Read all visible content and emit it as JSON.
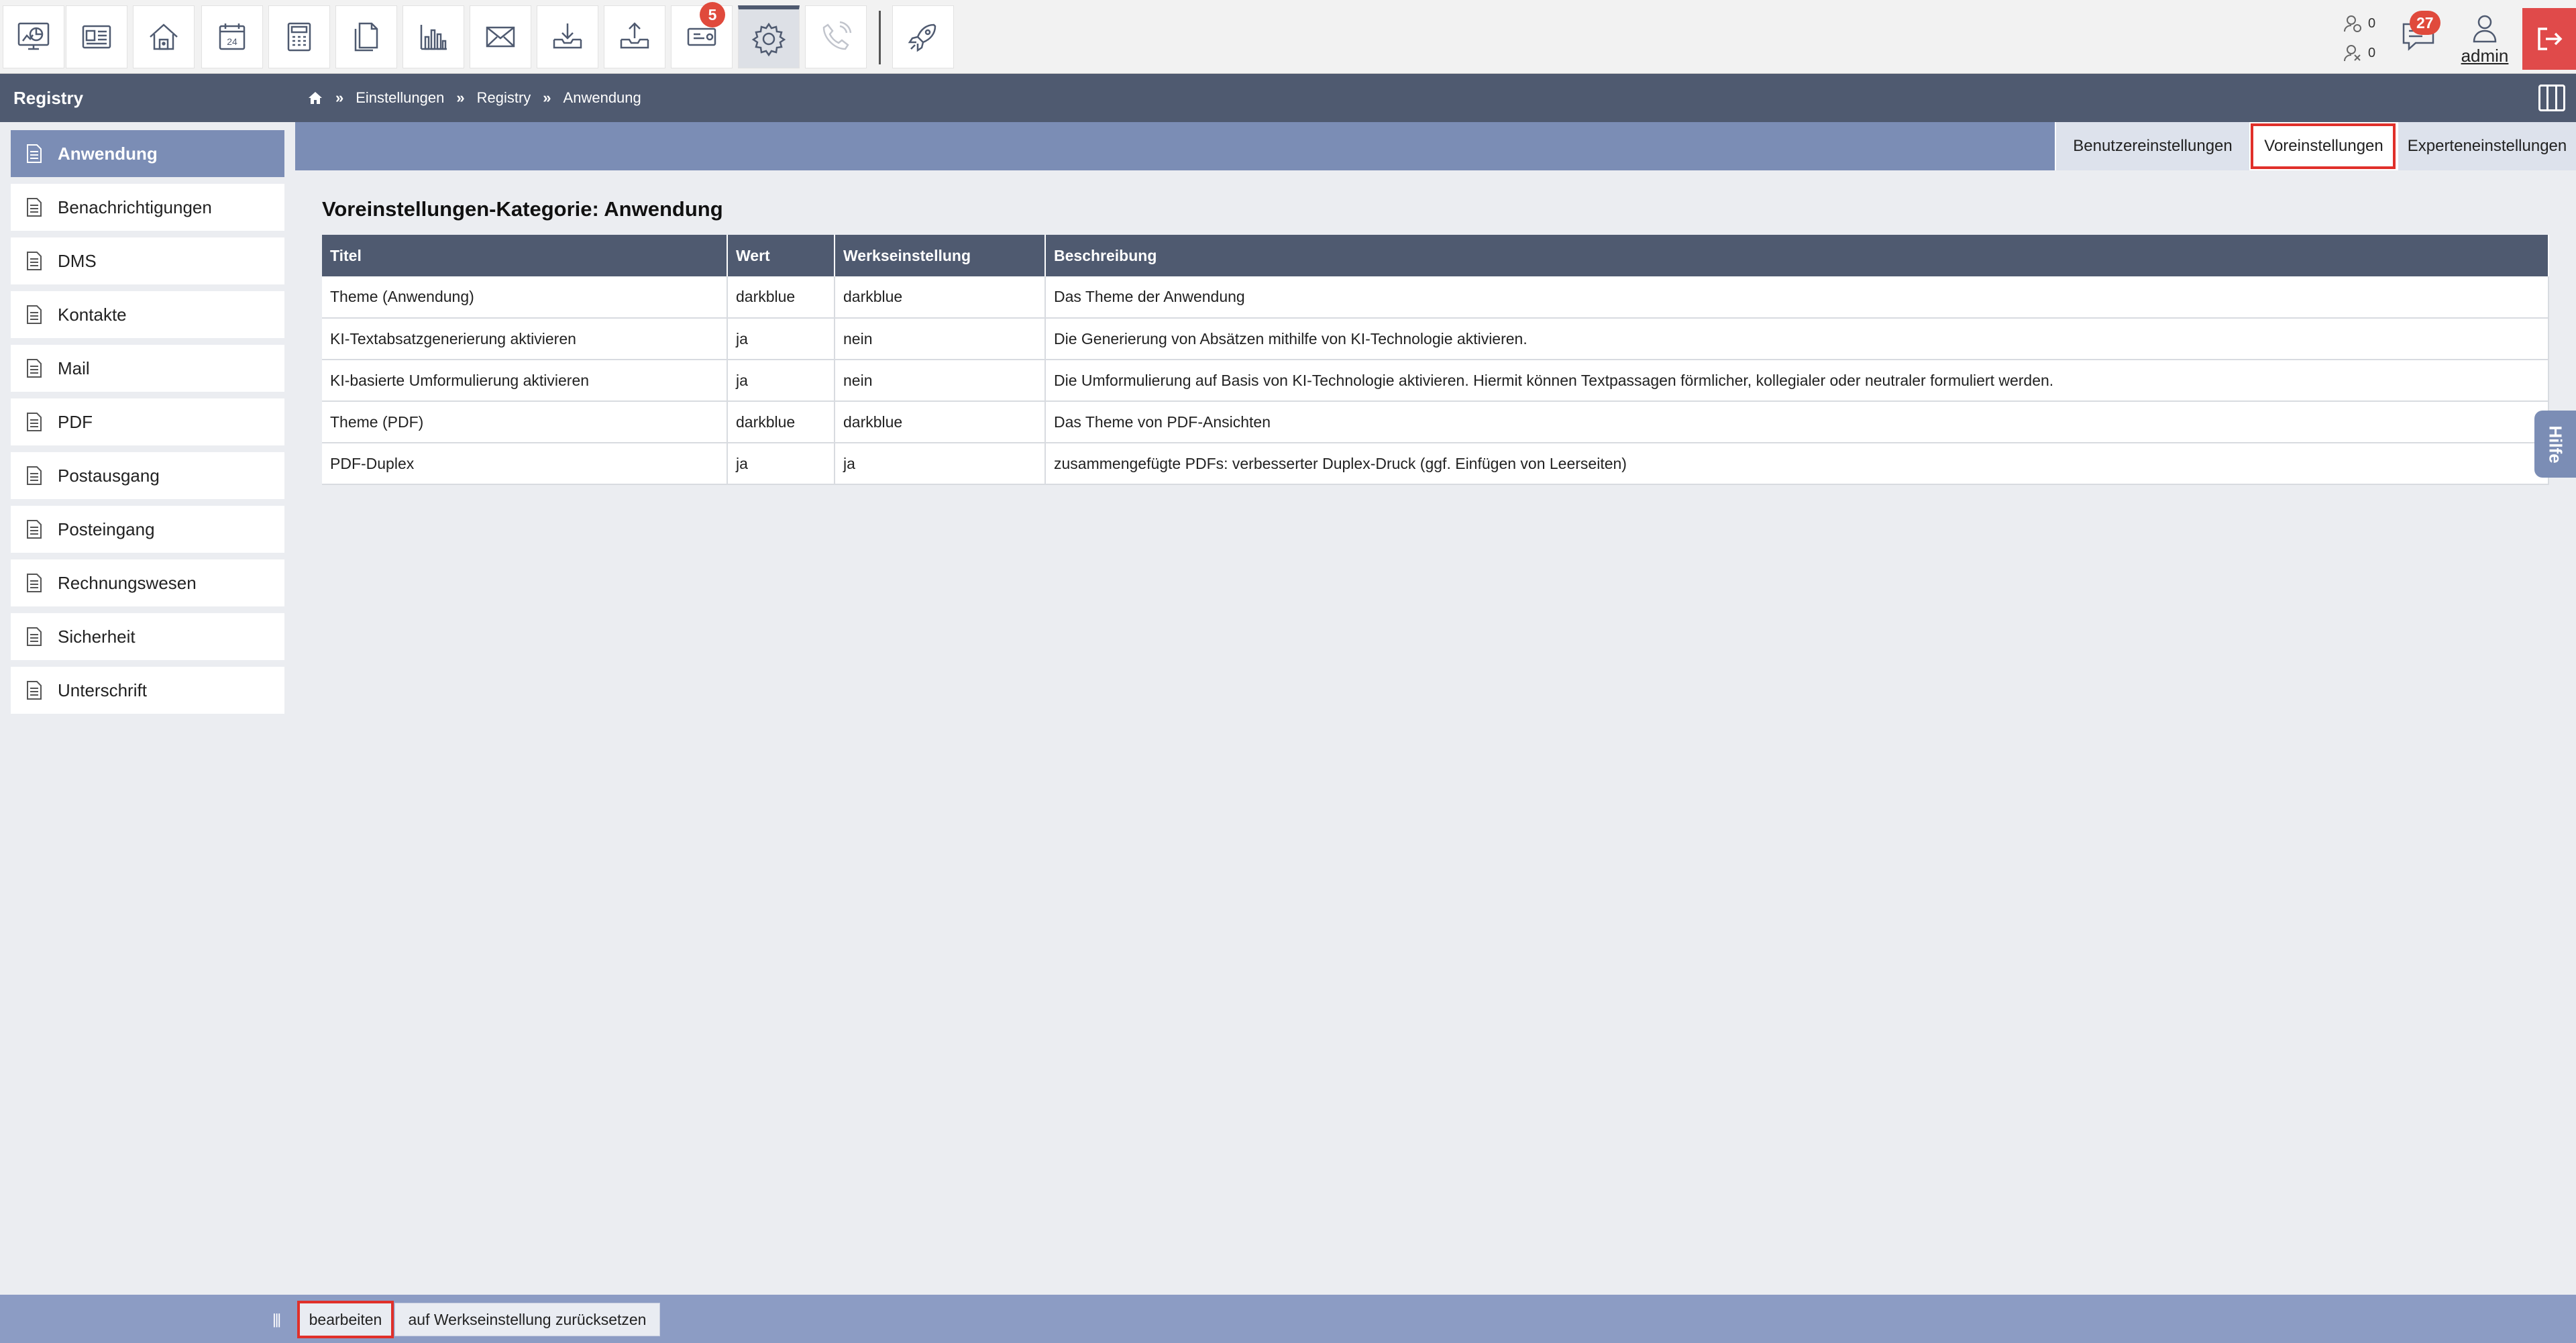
{
  "toolbar": {
    "items": [
      {
        "icon": "dashboard-icon"
      },
      {
        "icon": "contact-card-icon"
      },
      {
        "icon": "home-icon"
      },
      {
        "icon": "calendar-icon",
        "label": "24"
      },
      {
        "icon": "calculator-icon"
      },
      {
        "icon": "documents-icon"
      },
      {
        "icon": "bar-chart-icon"
      },
      {
        "icon": "mail-icon"
      },
      {
        "icon": "inbox-download-icon"
      },
      {
        "icon": "outbox-upload-icon"
      },
      {
        "icon": "ticket-icon",
        "badge": "5"
      },
      {
        "icon": "gear-icon",
        "active": true
      },
      {
        "icon": "phone-icon",
        "disabled": true
      },
      {
        "icon": "rocket-icon"
      }
    ],
    "calendar_day": "24",
    "ticket_badge": "5",
    "stat_a": "0",
    "stat_b": "0",
    "messages_badge": "27",
    "user_label": "admin",
    "colors": {
      "badge": "#e04a3c",
      "logout": "#e04a4a"
    }
  },
  "sidebar": {
    "title": "Registry",
    "items": [
      {
        "label": "Anwendung",
        "active": true
      },
      {
        "label": "Benachrichtigungen"
      },
      {
        "label": "DMS"
      },
      {
        "label": "Kontakte"
      },
      {
        "label": "Mail"
      },
      {
        "label": "PDF"
      },
      {
        "label": "Postausgang"
      },
      {
        "label": "Posteingang"
      },
      {
        "label": "Rechnungswesen"
      },
      {
        "label": "Sicherheit"
      },
      {
        "label": "Unterschrift"
      }
    ]
  },
  "breadcrumb": {
    "sep": "»",
    "items": [
      "Einstellungen",
      "Registry",
      "Anwendung"
    ]
  },
  "tabs": [
    {
      "label": "Benutzereinstellungen"
    },
    {
      "label": "Voreinstellungen",
      "selected": true
    },
    {
      "label": "Experteneinstellungen"
    }
  ],
  "main": {
    "title": "Voreinstellungen-Kategorie: Anwendung",
    "columns": [
      "Titel",
      "Wert",
      "Werkseinstellung",
      "Beschreibung"
    ],
    "rows": [
      [
        "Theme (Anwendung)",
        "darkblue",
        "darkblue",
        "Das Theme der Anwendung"
      ],
      [
        "KI-Textabsatzgenerierung aktivieren",
        "ja",
        "nein",
        "Die Generierung von Absätzen mithilfe von KI-Technologie aktivieren."
      ],
      [
        "KI-basierte Umformulierung aktivieren",
        "ja",
        "nein",
        "Die Umformulierung auf Basis von KI-Technologie aktivieren. Hiermit können Textpassagen förmlicher, kollegialer oder neutraler formuliert werden."
      ],
      [
        "Theme (PDF)",
        "darkblue",
        "darkblue",
        "Das Theme von PDF-Ansichten"
      ],
      [
        "PDF-Duplex",
        "ja",
        "ja",
        "zusammengefügte PDFs: verbesserter Duplex-Druck (ggf. Einfügen von Leerseiten)"
      ]
    ]
  },
  "help_tab": "Hilfe",
  "bottombar": {
    "edit_label": "bearbeiten",
    "reset_label": "auf Werkseinstellung zurücksetzen"
  },
  "colors": {
    "header_dark": "#4f5a70",
    "accent_blue": "#7b8db5",
    "highlight_red": "#e0302a"
  }
}
